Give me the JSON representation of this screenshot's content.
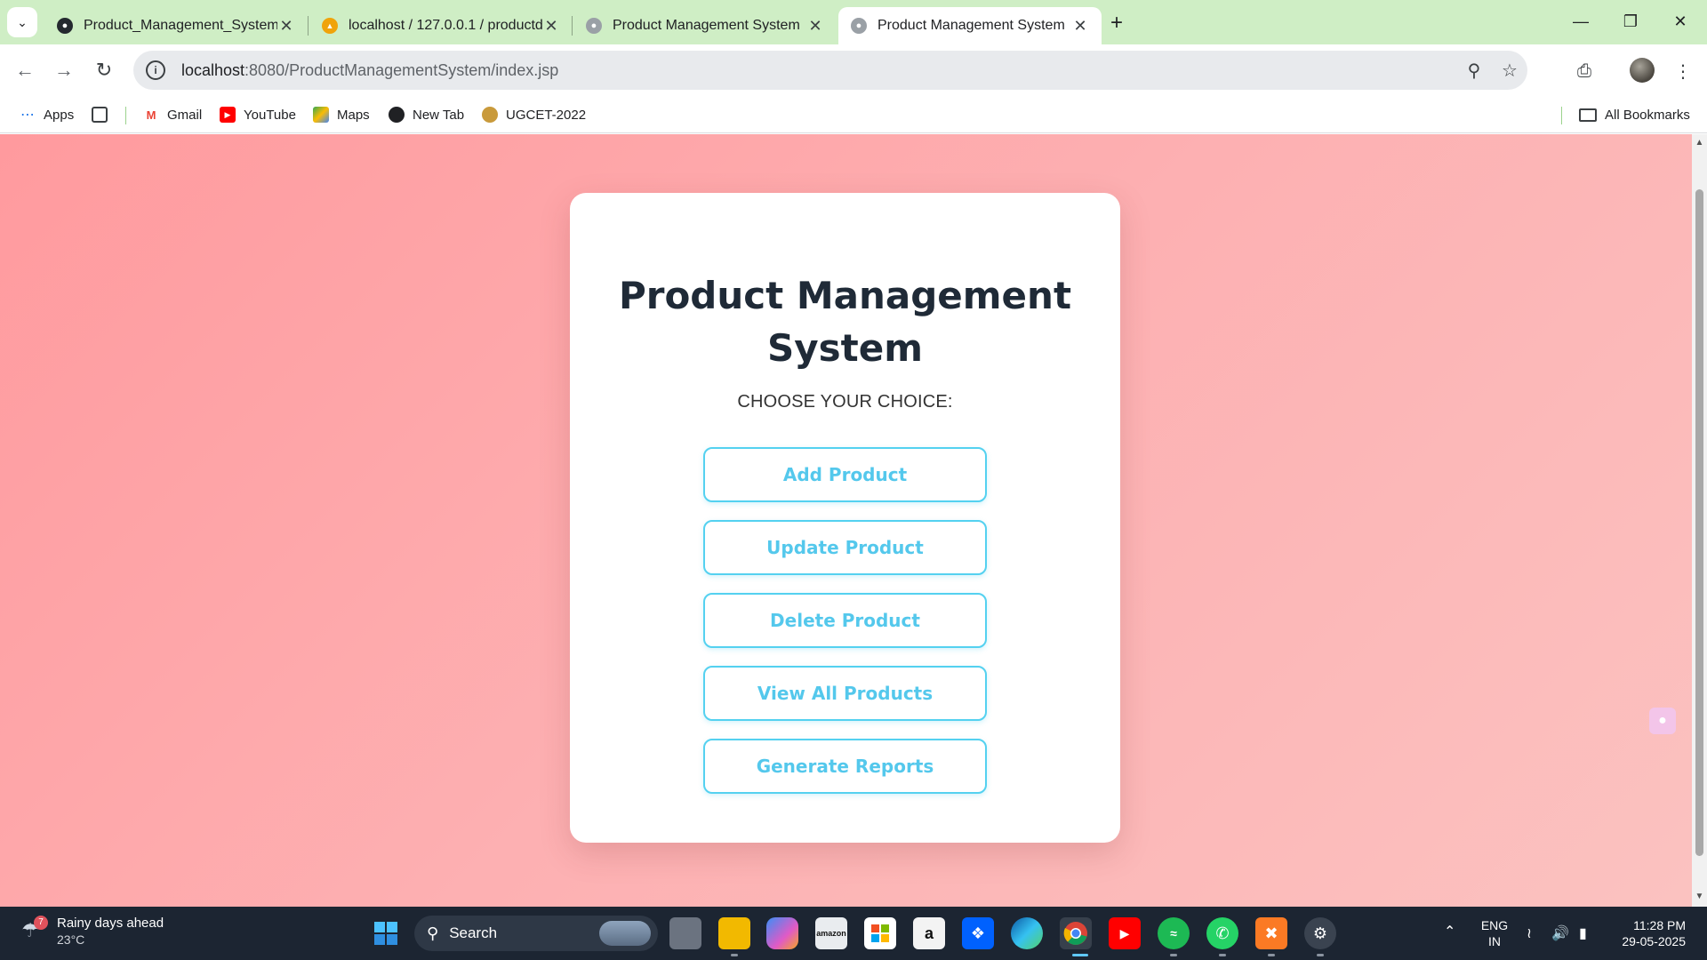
{
  "browser": {
    "tabs": [
      {
        "title": "Product_Management_System_",
        "favicon": "github-icon",
        "active": false
      },
      {
        "title": "localhost / 127.0.0.1 / productd",
        "favicon": "phpmyadmin-icon",
        "active": false
      },
      {
        "title": "Product Management System",
        "favicon": "globe-icon",
        "active": false
      },
      {
        "title": "Product Management System",
        "favicon": "globe-icon",
        "active": true
      }
    ],
    "url_host": "localhost",
    "url_path": ":8080/ProductManagementSystem/index.jsp",
    "bookmarks": [
      {
        "label": "Apps",
        "icon": "apps-grid-icon"
      },
      {
        "label": "",
        "icon": "tab-groups-icon"
      },
      {
        "label": "Gmail",
        "icon": "gmail-icon"
      },
      {
        "label": "YouTube",
        "icon": "youtube-icon"
      },
      {
        "label": "Maps",
        "icon": "maps-icon"
      },
      {
        "label": "New Tab",
        "icon": "globe-icon"
      },
      {
        "label": "UGCET-2022",
        "icon": "ugcet-icon"
      }
    ],
    "all_bookmarks_label": "All Bookmarks"
  },
  "page": {
    "title": "Product Management System",
    "subtitle": "CHOOSE YOUR CHOICE:",
    "buttons": [
      {
        "label": "Add Product"
      },
      {
        "label": "Update Product"
      },
      {
        "label": "Delete Product"
      },
      {
        "label": "View All Products"
      },
      {
        "label": "Generate Reports"
      }
    ],
    "accent_color": "#54d1f0",
    "background_gradient": [
      "#ff9a9e",
      "#fbc2c0"
    ]
  },
  "taskbar": {
    "weather_title": "Rainy days ahead",
    "weather_temp": "23°C",
    "weather_badge": "7",
    "search_placeholder": "Search",
    "language": "ENG",
    "region": "IN",
    "time": "11:28 PM",
    "date": "29-05-2025"
  }
}
